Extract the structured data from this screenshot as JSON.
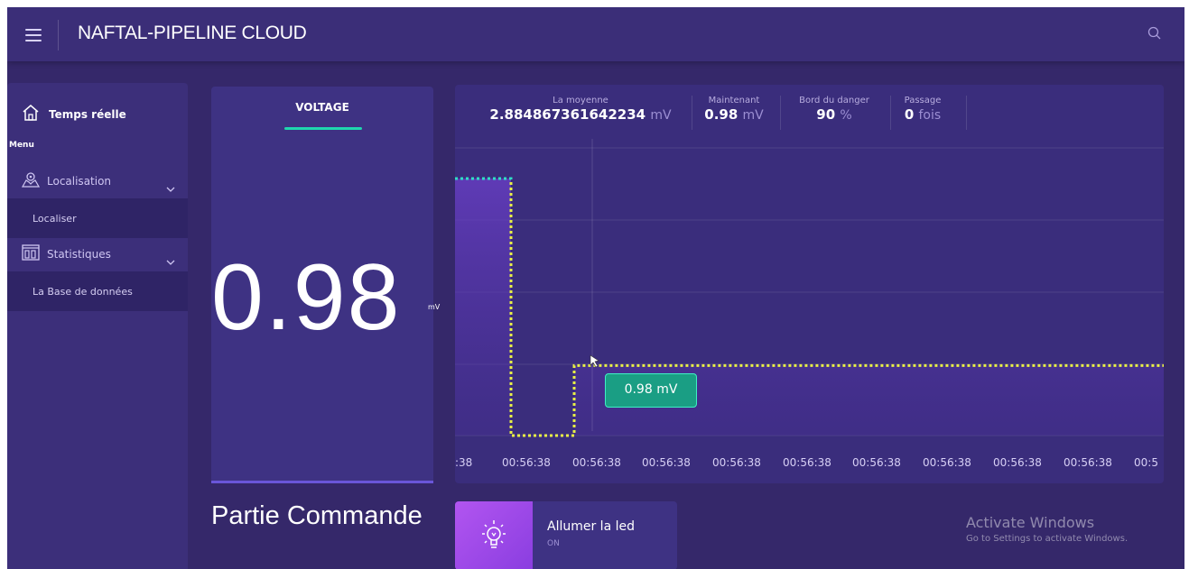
{
  "header": {
    "title": "NAFTAL-PIPELINE CLOUD",
    "menu_icon": "hamburger-icon",
    "search_icon": "search-icon"
  },
  "sidebar": {
    "home": {
      "label": "Temps réelle",
      "icon": "home-icon"
    },
    "menu_heading": "Menu",
    "groups": [
      {
        "label": "Localisation",
        "icon": "map-pin-icon",
        "sub": [
          "Localiser"
        ]
      },
      {
        "label": "Statistiques",
        "icon": "stats-icon",
        "sub": [
          "La Base de données"
        ]
      }
    ]
  },
  "voltage": {
    "tab_label": "VOLTAGE",
    "value": "0.98",
    "unit": "mV"
  },
  "stats": {
    "average": {
      "caption": "La moyenne",
      "value": "2.884867361642234",
      "unit": "mV"
    },
    "now": {
      "caption": "Maintenant",
      "value": "0.98",
      "unit": "mV"
    },
    "danger": {
      "caption": "Bord du danger",
      "value": "90",
      "unit": "%"
    },
    "passage": {
      "caption": "Passage",
      "value": "0",
      "unit": "fois"
    }
  },
  "chart_data": {
    "type": "line",
    "x": [
      "00:56:38",
      "00:56:38",
      "00:56:38",
      "00:56:38",
      "00:56:38",
      "00:56:38",
      "00:56:38",
      "00:56:38",
      "00:56:38",
      "00:56:38",
      "00:56:38"
    ],
    "series": [
      {
        "values": [
          3.6,
          3.6,
          0.0,
          0.98,
          0.98,
          0.98,
          0.98,
          0.98,
          0.98,
          0.98,
          0.98,
          0.98
        ]
      }
    ],
    "tooltip": "0.98 mV",
    "tick_labels": [
      ":38",
      "00:56:38",
      "00:56:38",
      "00:56:38",
      "00:56:38",
      "00:56:38",
      "00:56:38",
      "00:56:38",
      "00:56:38",
      "00:56:38",
      "00:5"
    ],
    "colors": {
      "line_high": "#2fe0c4",
      "line_low": "#e8f046",
      "area": "#6b3fc9"
    }
  },
  "commande": {
    "title": "Partie Commande",
    "led": {
      "label": "Allumer la led",
      "state": "ON",
      "icon": "lightbulb-icon"
    }
  },
  "watermark": {
    "line1": "Activate Windows",
    "line2": "Go to Settings to activate Windows."
  }
}
